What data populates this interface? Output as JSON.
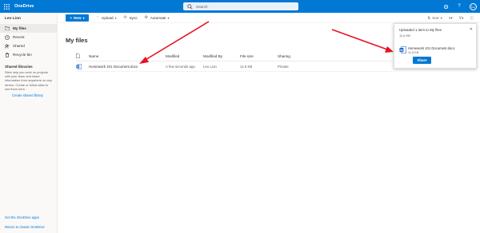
{
  "app": {
    "title": "OneDrive",
    "search_placeholder": "Search"
  },
  "user": {
    "name": "Leo Lion",
    "initials": "LL"
  },
  "sidebar": {
    "items": [
      {
        "label": "My files",
        "icon": "folder-icon",
        "active": true
      },
      {
        "label": "Recent",
        "icon": "clock-icon"
      },
      {
        "label": "Shared",
        "icon": "people-icon"
      },
      {
        "label": "Recycle bin",
        "icon": "recycle-bin-icon"
      }
    ],
    "libraries_heading": "Shared libraries",
    "libraries_description": "Sites help you work on projects with your team and share information from anywhere on any device. Create or follow sites to see them here.",
    "create_library_label": "Create shared library",
    "get_apps_label": "Get the OneDrive apps",
    "classic_label": "Return to classic OneDrive"
  },
  "toolbar": {
    "new_label": "New",
    "upload_label": "Upload",
    "sync_label": "Sync",
    "automate_label": "Automate",
    "sort_label": "Sort"
  },
  "main": {
    "title": "My files",
    "columns": [
      "Name",
      "Modified",
      "Modified By",
      "File size",
      "Sharing"
    ],
    "rows": [
      {
        "name": "Homework 101 Document.docx",
        "modified": "A few seconds ago",
        "modified_by": "Leo Lion",
        "size": "11.6 KB",
        "sharing": "Private"
      }
    ]
  },
  "toast": {
    "message": "Uploaded 1 item to My files",
    "size": "11.6 KB",
    "file_name": "Homework 101 Document.docx",
    "file_size": "11.6 KB",
    "share_label": "Share"
  },
  "colors": {
    "accent": "#0078d4",
    "annotation_arrow": "#e81123",
    "word_blue": "#185abd"
  }
}
